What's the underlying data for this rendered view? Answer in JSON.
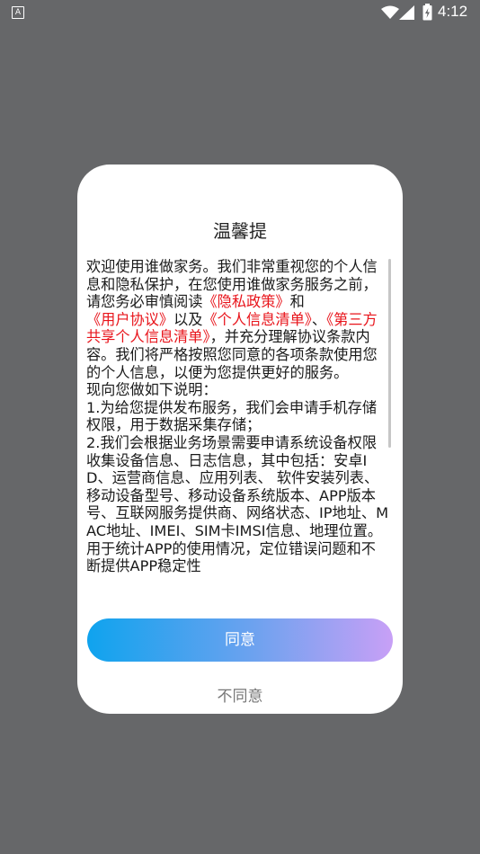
{
  "status_bar": {
    "notification_glyph": "A",
    "time": "4:12",
    "icons": [
      "wifi-icon",
      "signal-icon",
      "battery-icon"
    ]
  },
  "dialog": {
    "title": "温馨提",
    "intro_parts": [
      {
        "text": "欢迎使用谁做家务。我们非常重视您的个人信息和隐私保护，在您使用谁做家务服务之前，请您务必审慎阅读",
        "link": false
      },
      {
        "text": "《隐私政策》",
        "link": true
      },
      {
        "text": "和",
        "link": false
      },
      {
        "text": "《用户协议》",
        "link": true
      },
      {
        "text": "以及",
        "link": false
      },
      {
        "text": "《个人信息清单》",
        "link": true
      },
      {
        "text": "、",
        "link": false
      },
      {
        "text": "《第三方共享个人信息清单》",
        "link": true
      },
      {
        "text": "，并充分理解协议条款内容。我们将严格按照您同意的各项条款使用您的个人信息，以便为您提供更好的服务。",
        "link": false
      }
    ],
    "explanation_heading": " 现向您做如下说明：",
    "items": [
      " 1.为给您提供发布服务，我们会申请手机存储权限，用于数据采集存储；",
      " 2.我们会根据业务场景需要申请系统设备权限收集设备信息、日志信息，其中包括：安卓ID、运营商信息、应用列表、 软件安装列表、移动设备型号、移动设备系统版本、APP版本号、互联网服务提供商、网络状态、IP地址、MAC地址、IMEI、SIM卡IMSI信息、地理位置。用于统计APP的使用情况，定位错误问题和不断提供APP稳定性"
    ],
    "agree_label": "同意",
    "disagree_label": "不同意",
    "colors": {
      "link": "#e8131a",
      "button_gradient_start": "#0fa3ee",
      "button_gradient_end": "#c8a0f6",
      "overlay": "#666769"
    }
  }
}
